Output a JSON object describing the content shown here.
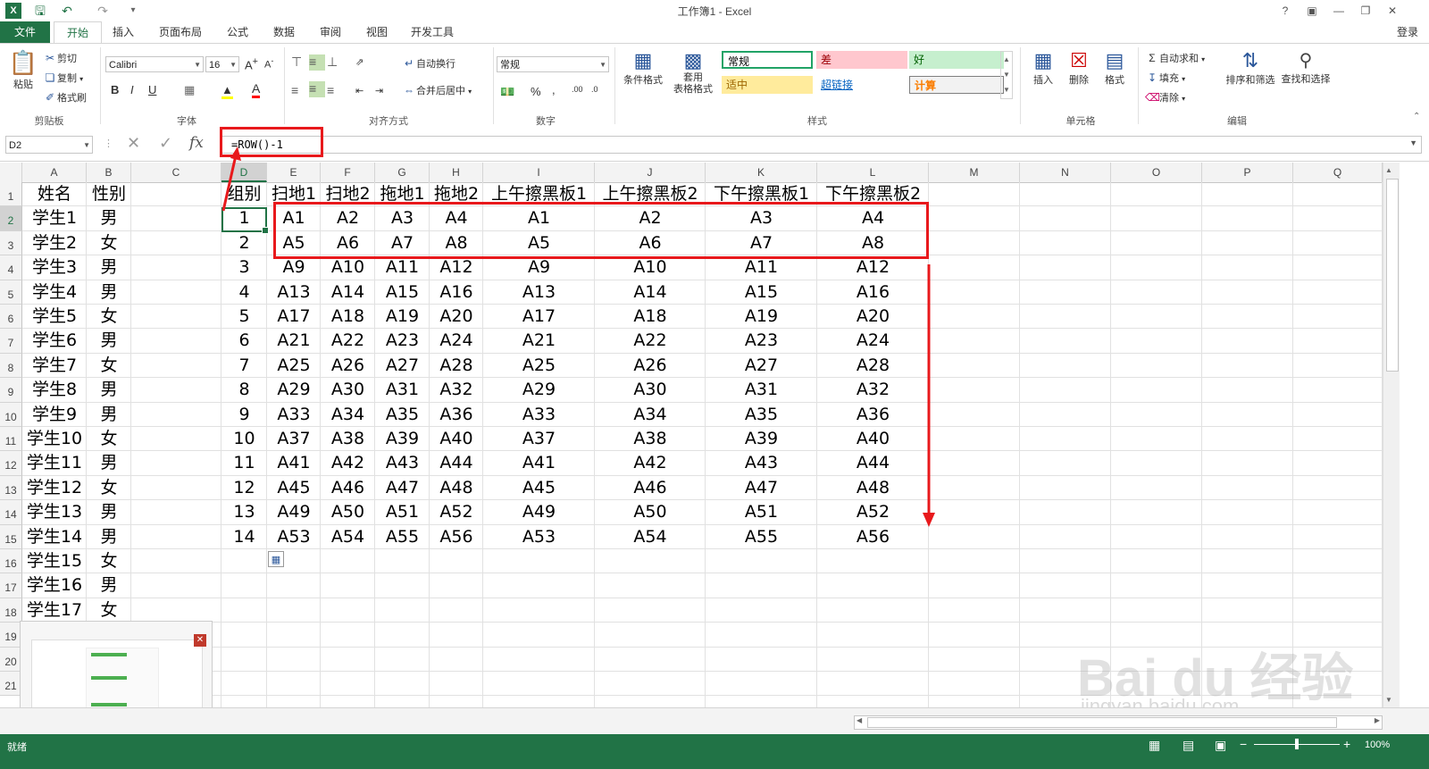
{
  "window": {
    "title": "工作簿1 - Excel",
    "login": "登录"
  },
  "tabs": [
    {
      "label": "文件"
    },
    {
      "label": "开始"
    },
    {
      "label": "插入"
    },
    {
      "label": "页面布局"
    },
    {
      "label": "公式"
    },
    {
      "label": "数据"
    },
    {
      "label": "审阅"
    },
    {
      "label": "视图"
    },
    {
      "label": "开发工具"
    }
  ],
  "ribbon": {
    "clipboard": {
      "paste": "粘贴",
      "cut": "剪切",
      "copy": "复制",
      "format_painter": "格式刷",
      "label": "剪贴板"
    },
    "font": {
      "name": "Calibri",
      "size": "16",
      "bold": "B",
      "italic": "I",
      "underline": "U",
      "label": "字体"
    },
    "align": {
      "wrap": "自动换行",
      "merge": "合并后居中",
      "label": "对齐方式"
    },
    "number": {
      "format": "常规",
      "percent": "%",
      "comma": ",",
      "label": "数字"
    },
    "styles": {
      "cond_format": "条件格式",
      "table_format": "套用\n表格格式",
      "cells": [
        {
          "text": "常规",
          "bg": "#ffffff",
          "color": "#000000"
        },
        {
          "text": "差",
          "bg": "#ffc7ce",
          "color": "#9c0006"
        },
        {
          "text": "好",
          "bg": "#c6efce",
          "color": "#006100"
        },
        {
          "text": "适中",
          "bg": "#ffeb9c",
          "color": "#9c6500"
        },
        {
          "text": "超链接",
          "bg": "#ffffff",
          "color": "#0563c1"
        },
        {
          "text": "计算",
          "bg": "#f2f2f2",
          "color": "#fa7d00"
        }
      ],
      "label": "样式"
    },
    "cells_grp": {
      "insert": "插入",
      "delete": "删除",
      "format": "格式",
      "label": "单元格"
    },
    "editing": {
      "autosum": "自动求和",
      "fill": "填充",
      "clear": "清除",
      "sort": "排序和筛选",
      "find": "查找和选择",
      "label": "编辑"
    }
  },
  "formula_bar": {
    "name_box": "D2",
    "fx": "fx",
    "formula": "=ROW()-1"
  },
  "columns": [
    "A",
    "B",
    "C",
    "D",
    "E",
    "F",
    "G",
    "H",
    "I",
    "J",
    "K",
    "L",
    "M",
    "N",
    "O",
    "P",
    "Q"
  ],
  "row_numbers": [
    "1",
    "2",
    "3",
    "4",
    "5",
    "6",
    "7",
    "8",
    "9",
    "10",
    "11",
    "12",
    "13",
    "14",
    "15",
    "16",
    "17",
    "18",
    "19",
    "20",
    "21"
  ],
  "sheet": {
    "header": [
      "姓名",
      "性别",
      "",
      "组别",
      "扫地1",
      "扫地2",
      "拖地1",
      "拖地2",
      "上午擦黑板1",
      "上午擦黑板2",
      "下午擦黑板1",
      "下午擦黑板2"
    ],
    "students": [
      [
        "学生1",
        "男"
      ],
      [
        "学生2",
        "女"
      ],
      [
        "学生3",
        "男"
      ],
      [
        "学生4",
        "男"
      ],
      [
        "学生5",
        "女"
      ],
      [
        "学生6",
        "男"
      ],
      [
        "学生7",
        "女"
      ],
      [
        "学生8",
        "男"
      ],
      [
        "学生9",
        "男"
      ],
      [
        "学生10",
        "女"
      ],
      [
        "学生11",
        "男"
      ],
      [
        "学生12",
        "女"
      ],
      [
        "学生13",
        "男"
      ],
      [
        "学生14",
        "男"
      ],
      [
        "学生15",
        "女"
      ],
      [
        "学生16",
        "男"
      ],
      [
        "学生17",
        "女"
      ]
    ],
    "groups": [
      [
        "1",
        "A1",
        "A2",
        "A3",
        "A4",
        "A1",
        "A2",
        "A3",
        "A4"
      ],
      [
        "2",
        "A5",
        "A6",
        "A7",
        "A8",
        "A5",
        "A6",
        "A7",
        "A8"
      ],
      [
        "3",
        "A9",
        "A10",
        "A11",
        "A12",
        "A9",
        "A10",
        "A11",
        "A12"
      ],
      [
        "4",
        "A13",
        "A14",
        "A15",
        "A16",
        "A13",
        "A14",
        "A15",
        "A16"
      ],
      [
        "5",
        "A17",
        "A18",
        "A19",
        "A20",
        "A17",
        "A18",
        "A19",
        "A20"
      ],
      [
        "6",
        "A21",
        "A22",
        "A23",
        "A24",
        "A21",
        "A22",
        "A23",
        "A24"
      ],
      [
        "7",
        "A25",
        "A26",
        "A27",
        "A28",
        "A25",
        "A26",
        "A27",
        "A28"
      ],
      [
        "8",
        "A29",
        "A30",
        "A31",
        "A32",
        "A29",
        "A30",
        "A31",
        "A32"
      ],
      [
        "9",
        "A33",
        "A34",
        "A35",
        "A36",
        "A33",
        "A34",
        "A35",
        "A36"
      ],
      [
        "10",
        "A37",
        "A38",
        "A39",
        "A40",
        "A37",
        "A38",
        "A39",
        "A40"
      ],
      [
        "11",
        "A41",
        "A42",
        "A43",
        "A44",
        "A41",
        "A42",
        "A43",
        "A44"
      ],
      [
        "12",
        "A45",
        "A46",
        "A47",
        "A48",
        "A45",
        "A46",
        "A47",
        "A48"
      ],
      [
        "13",
        "A49",
        "A50",
        "A51",
        "A52",
        "A49",
        "A50",
        "A51",
        "A52"
      ],
      [
        "14",
        "A53",
        "A54",
        "A55",
        "A56",
        "A53",
        "A54",
        "A55",
        "A56"
      ]
    ]
  },
  "status": {
    "ready": "就绪",
    "zoom": "100%"
  },
  "watermark": {
    "brand": "Bai du 经验",
    "url": "jingyan.baidu.com"
  },
  "colors": {
    "excel_green": "#217346",
    "annotation_red": "#e8191c"
  }
}
